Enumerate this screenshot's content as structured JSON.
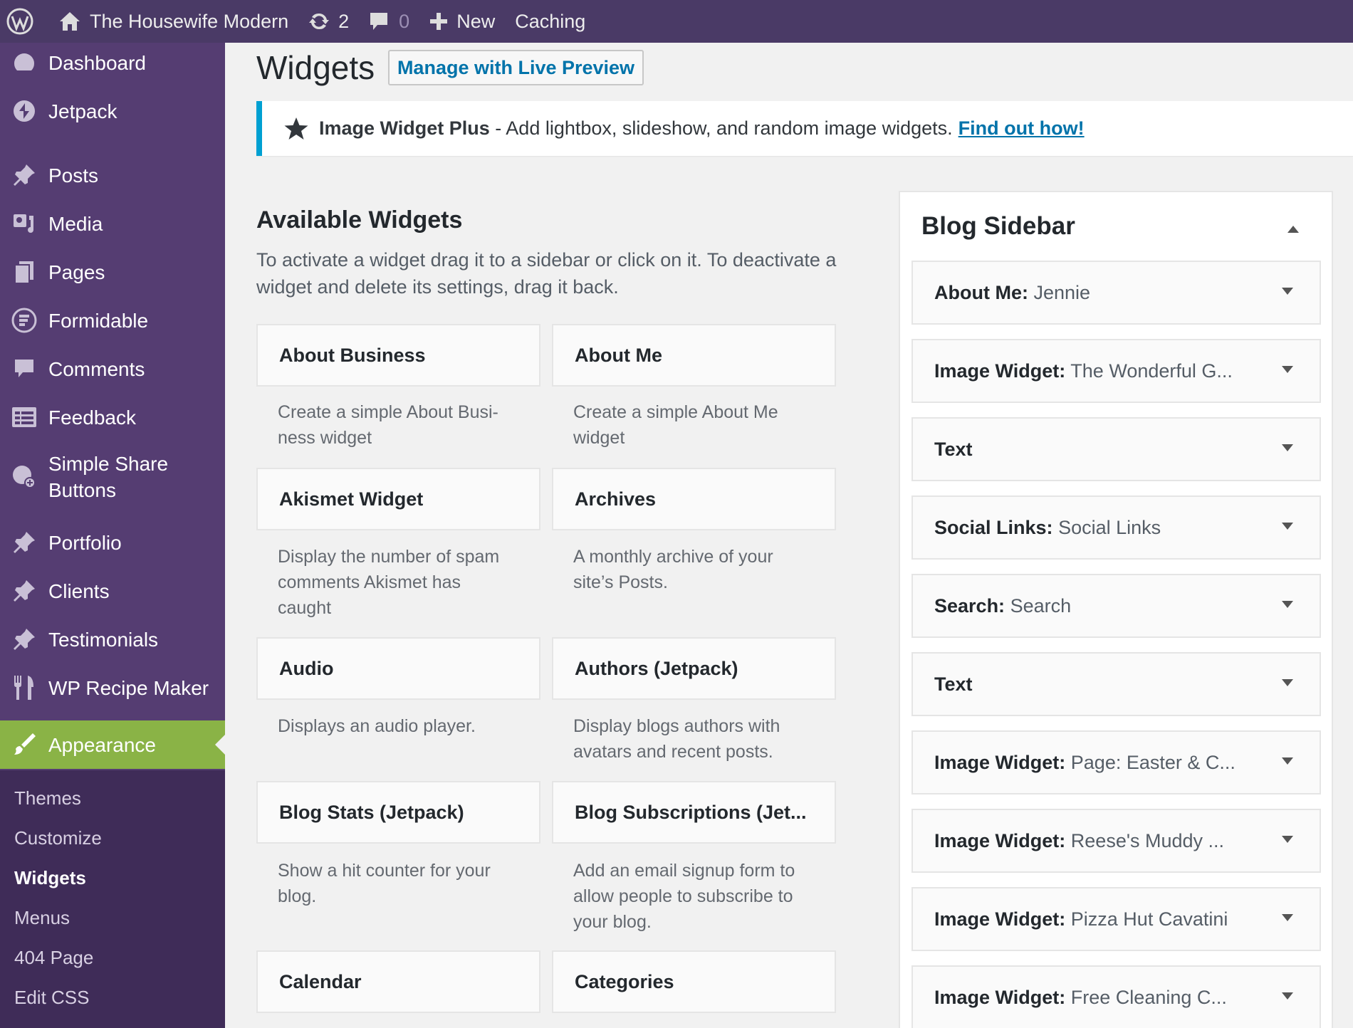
{
  "adminbar": {
    "site_name": "The Housewife Modern",
    "updates_count": "2",
    "comments_count": "0",
    "new_label": "New",
    "caching_label": "Caching"
  },
  "sidebar": {
    "items": [
      {
        "label": "Dashboard",
        "icon": "dashboard-icon"
      },
      {
        "label": "Jetpack",
        "icon": "jetpack-icon"
      },
      {
        "label": "Posts",
        "icon": "pin-icon"
      },
      {
        "label": "Media",
        "icon": "media-icon"
      },
      {
        "label": "Pages",
        "icon": "pages-icon"
      },
      {
        "label": "Formidable",
        "icon": "formidable-icon"
      },
      {
        "label": "Comments",
        "icon": "comment-icon"
      },
      {
        "label": "Feedback",
        "icon": "feedback-icon"
      },
      {
        "label": "Simple Share Buttons",
        "icon": "share-icon"
      },
      {
        "label": "Portfolio",
        "icon": "pin-icon"
      },
      {
        "label": "Clients",
        "icon": "pin-icon"
      },
      {
        "label": "Testimonials",
        "icon": "pin-icon"
      },
      {
        "label": "WP Recipe Maker",
        "icon": "fork-knife-icon"
      },
      {
        "label": "Appearance",
        "icon": "paintbrush-icon"
      }
    ],
    "submenu": [
      "Themes",
      "Customize",
      "Widgets",
      "Menus",
      "404 Page",
      "Edit CSS"
    ],
    "active_submenu": "Widgets"
  },
  "page": {
    "title": "Widgets",
    "live_preview_label": "Manage with Live Preview"
  },
  "notice": {
    "bold": "Image Widget Plus",
    "text": " - Add lightbox, slideshow, and random image widgets.",
    "link": "Find out how!"
  },
  "available": {
    "heading": "Available Widgets",
    "description": "To activate a widget drag it to a sidebar or click on it. To deactivate a widget and delete its settings, drag it back.",
    "widgets": [
      {
        "title": "About Business",
        "desc": "Create a simple About Busi-\nness widget"
      },
      {
        "title": "About Me",
        "desc": "Create a simple About Me\nwidget"
      },
      {
        "title": "Akismet Widget",
        "desc": "Display the number of spam\ncomments Akismet has\ncaught"
      },
      {
        "title": "Archives",
        "desc": "A monthly archive of your\nsite’s Posts."
      },
      {
        "title": "Audio",
        "desc": "Displays an audio player."
      },
      {
        "title": "Authors (Jetpack)",
        "desc": "Display blogs authors with\navatars and recent posts."
      },
      {
        "title": "Blog Stats (Jetpack)",
        "desc": "Show a hit counter for your\nblog."
      },
      {
        "title": "Blog Subscriptions (Jet...",
        "desc": "Add an email signup form to\nallow people to subscribe to\nyour blog."
      },
      {
        "title": "Calendar",
        "desc": ""
      },
      {
        "title": "Categories",
        "desc": ""
      }
    ]
  },
  "blog_sidebar": {
    "title": "Blog Sidebar",
    "widgets": [
      {
        "name": "About Me",
        "sub": "Jennie"
      },
      {
        "name": "Image Widget",
        "sub": "The Wonderful G..."
      },
      {
        "name": "Text",
        "sub": ""
      },
      {
        "name": "Social Links",
        "sub": "Social Links"
      },
      {
        "name": "Search",
        "sub": "Search"
      },
      {
        "name": "Text",
        "sub": ""
      },
      {
        "name": "Image Widget",
        "sub": "Page: Easter & C..."
      },
      {
        "name": "Image Widget",
        "sub": "Reese's Muddy ..."
      },
      {
        "name": "Image Widget",
        "sub": "Pizza Hut Cavatini"
      },
      {
        "name": "Image Widget",
        "sub": "Free Cleaning C..."
      }
    ]
  },
  "colors": {
    "adminbar_bg": "#4a3a66",
    "sidebar_bg": "#553d72",
    "submenu_bg": "#3f2c58",
    "current_menu_bg": "#8ab346",
    "link": "#0073aa",
    "notice_border": "#00a0d2"
  }
}
